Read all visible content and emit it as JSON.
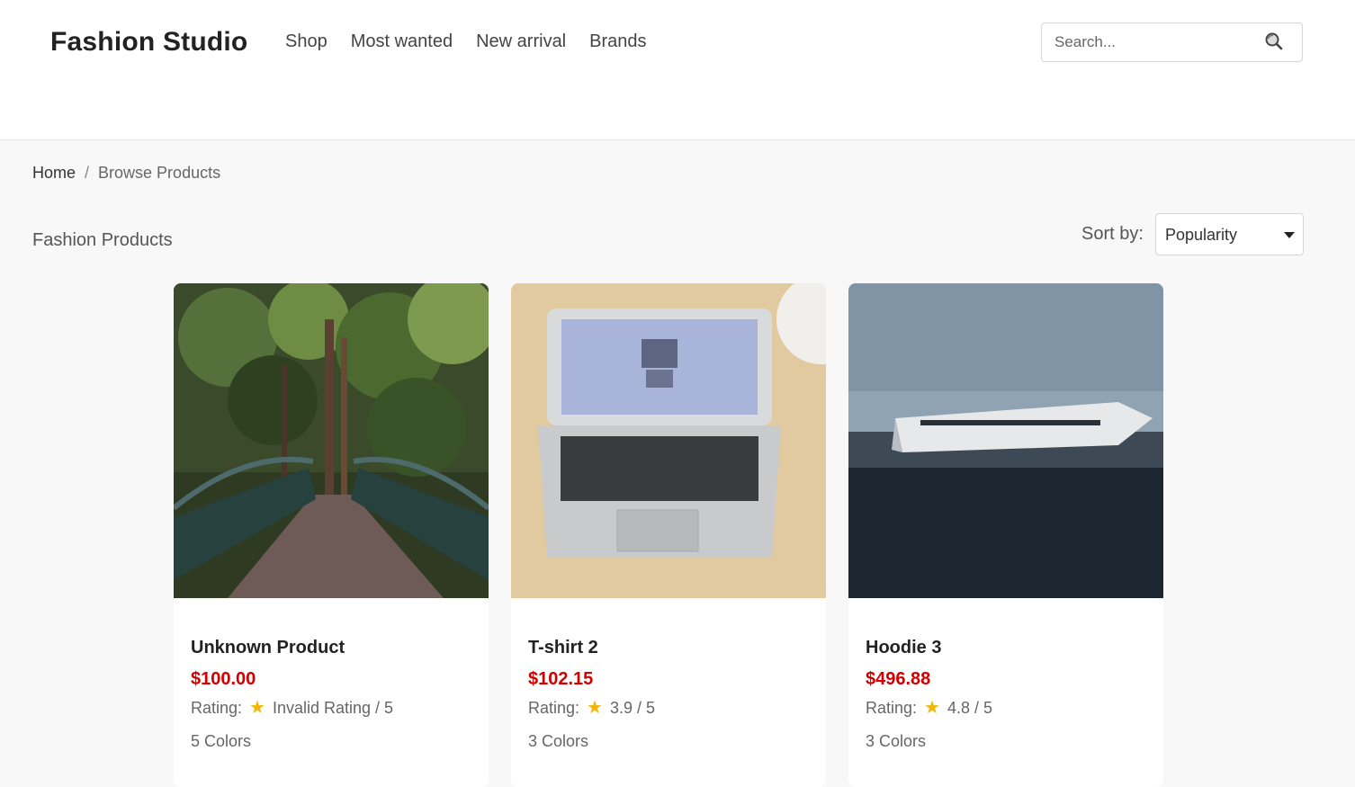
{
  "header": {
    "brand": "Fashion Studio",
    "nav": [
      "Shop",
      "Most wanted",
      "New arrival",
      "Brands"
    ],
    "search_placeholder": "Search..."
  },
  "breadcrumb": {
    "home": "Home",
    "separator": "/",
    "current": "Browse Products"
  },
  "toolbar": {
    "title": "Fashion Products",
    "sort_label": "Sort by:",
    "sort_value": "Popularity"
  },
  "rating_label": "Rating:",
  "products": [
    {
      "name": "Unknown Product",
      "price": "$100.00",
      "rating": "Invalid Rating / 5",
      "colors": "5 Colors",
      "image": "forest-bridge"
    },
    {
      "name": "T-shirt 2",
      "price": "$102.15",
      "rating": "3.9 / 5",
      "colors": "3 Colors",
      "image": "laptop-on-desk"
    },
    {
      "name": "Hoodie 3",
      "price": "$496.88",
      "rating": "4.8 / 5",
      "colors": "3 Colors",
      "image": "plane-wreck"
    }
  ],
  "colors": {
    "price": "#d40000",
    "star": "#f2b705",
    "brand_text": "#222222"
  }
}
